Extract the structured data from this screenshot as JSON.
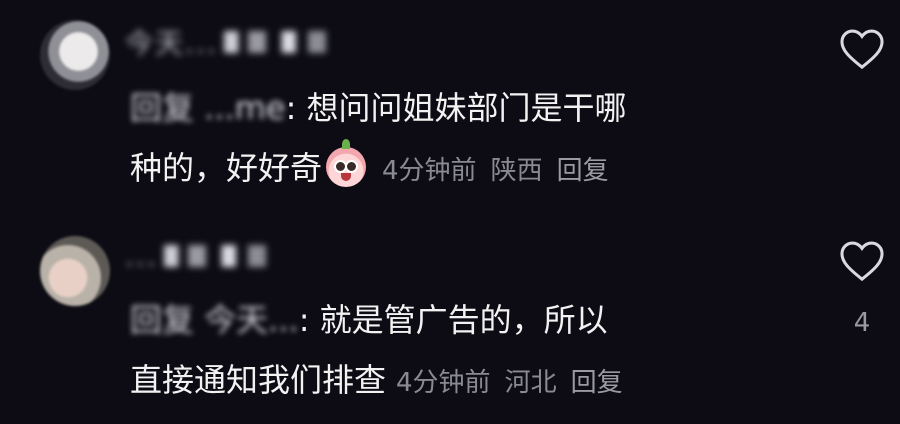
{
  "comments": [
    {
      "username": "今天...",
      "reply_to": "回复 ...me",
      "text_line1": "想问问姐妹部门是干哪",
      "text_line2": "种的，好好奇",
      "emoji": "surprised-face-emoji",
      "time": "4分钟前",
      "location": "陕西",
      "reply_label": "回复",
      "like_count": ""
    },
    {
      "username": "...",
      "reply_to": "回复 今天...",
      "text_line1": "就是管广告的，所以",
      "text_line2": "直接通知我们排查",
      "time": "4分钟前",
      "location": "河北",
      "reply_label": "回复",
      "like_count": "4"
    }
  ]
}
